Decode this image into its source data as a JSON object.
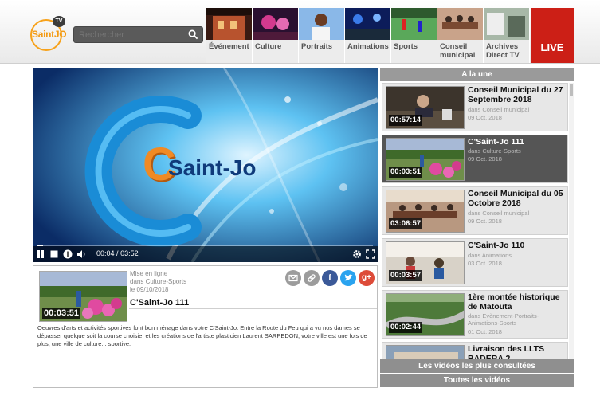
{
  "header": {
    "logo": {
      "brand": "SaintJO",
      "badge": "TV"
    },
    "search": {
      "placeholder": "Rechercher"
    },
    "nav": [
      {
        "label": "Événement",
        "icon": "event-thumb",
        "color": "#7a2b1c"
      },
      {
        "label": "Culture",
        "icon": "culture-thumb",
        "color": "#8c1e6e"
      },
      {
        "label": "Portraits",
        "icon": "portraits-thumb",
        "color": "#3c7bc7"
      },
      {
        "label": "Animations",
        "icon": "animations-thumb",
        "color": "#1d4ea8"
      },
      {
        "label": "Sports",
        "icon": "sports-thumb",
        "color": "#3c8a3c"
      },
      {
        "label": "Conseil municipal",
        "icon": "council-thumb",
        "color": "#9a6a52"
      },
      {
        "label": "Archives Direct TV",
        "icon": "archives-thumb",
        "color": "#6e8a6e"
      }
    ],
    "live_label": "LIVE"
  },
  "player": {
    "brand_text": "Saint-Jo",
    "brand_letter": "C",
    "time_current": "00:04",
    "time_total": "03:52",
    "progress": 0.017
  },
  "detail": {
    "duration": "00:03:51",
    "meta_line1": "Mise en ligne",
    "meta_line2": "dans Culture-Sports",
    "meta_line3": "le 09/10/2018",
    "title": "C'Saint-Jo 111",
    "share_icons": [
      "email-icon",
      "link-icon",
      "facebook-icon",
      "twitter-icon",
      "googleplus-icon"
    ],
    "description": "Oeuvres d'arts et activités sportives font bon ménage dans votre C'Saint-Jo. Entre la Route du Feu qui a vu nos dames se dépasser quelque soit la course choisie, et les créations de l'artiste plasticien Laurent SARPEDON, votre ville est une fois de plus, une ville de culture... sportive."
  },
  "sidebar": {
    "heading": "A la une",
    "items": [
      {
        "title": "Conseil Municipal du 27 Septembre 2018",
        "category": "dans Conseil municipal",
        "date": "09 Oct. 2018",
        "duration": "00:57:14",
        "active": false
      },
      {
        "title": "C'Saint-Jo 111",
        "category": "dans Culture-Sports",
        "date": "09 Oct. 2018",
        "duration": "00:03:51",
        "active": true
      },
      {
        "title": "Conseil Municipal du 05 Octobre 2018",
        "category": "dans Conseil municipal",
        "date": "09 Oct. 2018",
        "duration": "03:06:57",
        "active": false
      },
      {
        "title": "C'Saint-Jo 110",
        "category": "dans Animations",
        "date": "03 Oct. 2018",
        "duration": "00:03:57",
        "active": false
      },
      {
        "title": "1ère montée historique de Matouta",
        "category": "dans Evènement-Portraits-Animations-Sports",
        "date": "01 Oct. 2018",
        "duration": "00:02:44",
        "active": false
      },
      {
        "title": "Livraison des LLTS BADERA 2",
        "category": "",
        "date": "",
        "duration": "",
        "active": false
      }
    ],
    "most_viewed_label": "Les vidéos les plus consultées",
    "all_videos_label": "Toutes les vidéos"
  }
}
